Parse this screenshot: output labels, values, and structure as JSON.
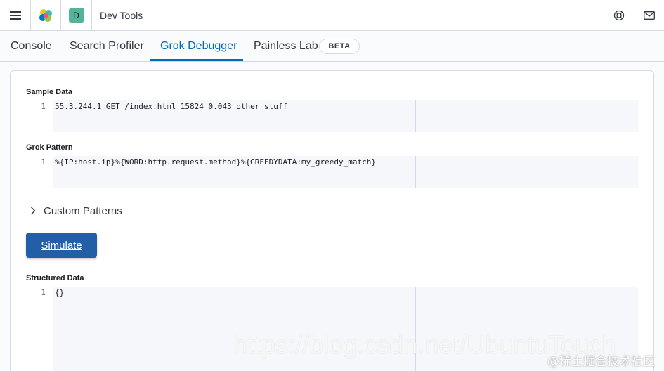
{
  "header": {
    "space_initial": "D",
    "app_title": "Dev Tools"
  },
  "tabs": [
    {
      "label": "Console"
    },
    {
      "label": "Search Profiler"
    },
    {
      "label": "Grok Debugger",
      "active": true
    },
    {
      "label": "Painless Lab",
      "badge": "BETA"
    }
  ],
  "sample_data": {
    "label": "Sample Data",
    "line_number": "1",
    "value": "55.3.244.1 GET /index.html 15824 0.043 other stuff"
  },
  "grok_pattern": {
    "label": "Grok Pattern",
    "line_number": "1",
    "value": "%{IP:host.ip}%{WORD:http.request.method}%{GREEDYDATA:my_greedy_match}"
  },
  "custom_patterns": {
    "label": "Custom Patterns"
  },
  "simulate_button": {
    "label": "Simulate"
  },
  "structured_data": {
    "label": "Structured Data",
    "line_number": "1",
    "value": "{}"
  },
  "watermark": {
    "url": "https://blog.csdn.net/UbuntuTouch",
    "community": "@稀土掘金技术社区"
  },
  "colors": {
    "accent": "#006bb4",
    "button": "#225fa6",
    "space_badge": "#54b399"
  }
}
